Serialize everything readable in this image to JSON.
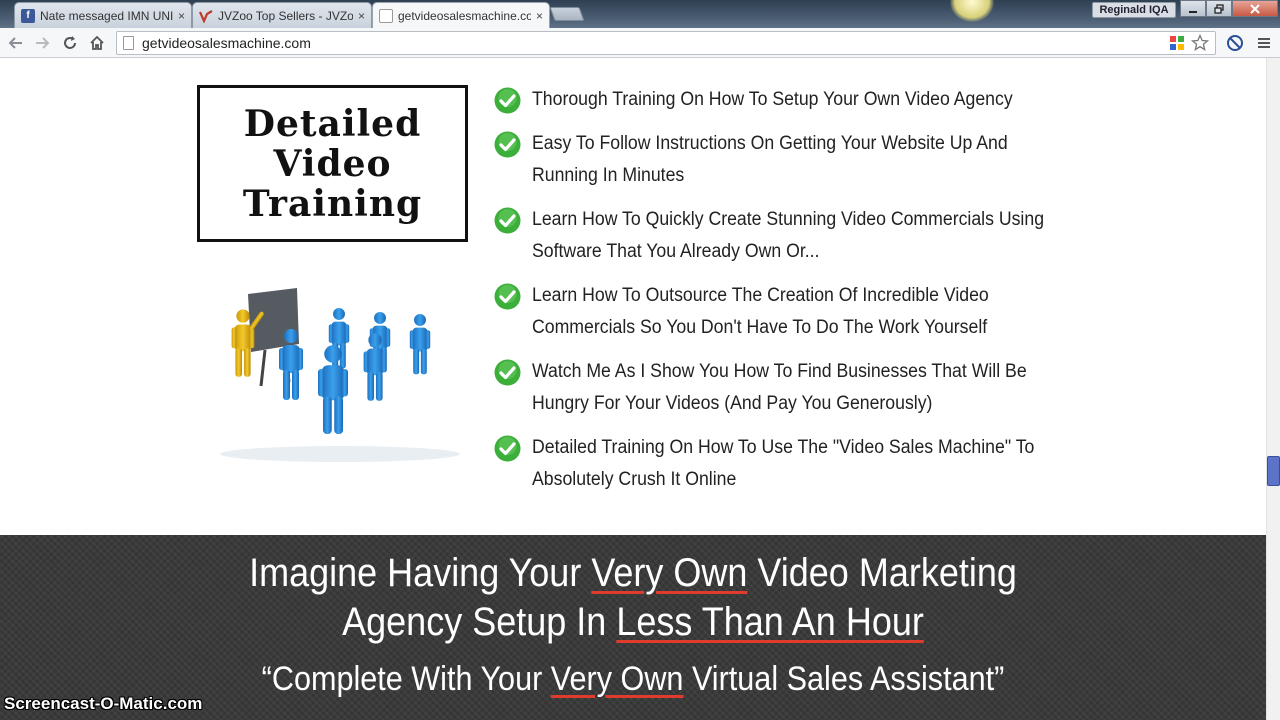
{
  "browser": {
    "tabs": [
      {
        "title": "Nate messaged IMN UNIV",
        "favicon": "facebook-icon",
        "color": "#3b5998",
        "active": false
      },
      {
        "title": "JVZoo Top Sellers - JVZoo",
        "favicon": "jvzoo-icon",
        "color": "#c0392b",
        "active": false
      },
      {
        "title": "getvideosalesmachine.com",
        "favicon": "page-icon",
        "color": "#888888",
        "active": true
      }
    ],
    "tab_close": "×",
    "user": "Reginald IQA",
    "url": "getvideosalesmachine.com"
  },
  "hero": {
    "training_box_lines": [
      "Detailed",
      "Video",
      "Training"
    ]
  },
  "features": [
    "Thorough Training On How To Setup Your Own Video Agency",
    "Easy To Follow Instructions On Getting Your Website Up And Running In Minutes",
    "Learn How To Quickly Create Stunning Video Commercials Using Software That You Already Own Or...",
    "Learn How To Outsource The Creation Of Incredible Video Commercials So You Don't Have To Do The Work Yourself",
    "Watch Me As I Show You How To Find Businesses That Will Be Hungry For Your Videos (And Pay You Generously)",
    "Detailed Training On How To Use The \"Video Sales Machine\" To Absolutely Crush It Online"
  ],
  "banner": {
    "line1_a": "Imagine Having Your ",
    "line1_u": "Very Own",
    "line1_b": " Video Marketing",
    "line2_a": "Agency Setup In ",
    "line2_u": "Less Than An Hour",
    "line3_a": "“Complete With Your ",
    "line3_u": "Very Own",
    "line3_b": " Virtual Sales Assistant”"
  },
  "watermark": "Screencast-O-Matic.com",
  "colors": {
    "check_green": "#3cae3a",
    "underline_red": "#e03c2e",
    "banner_bg": "#3a3a3a",
    "figure_blue": "#2d8fd8",
    "figure_yellow": "#e8b817"
  }
}
